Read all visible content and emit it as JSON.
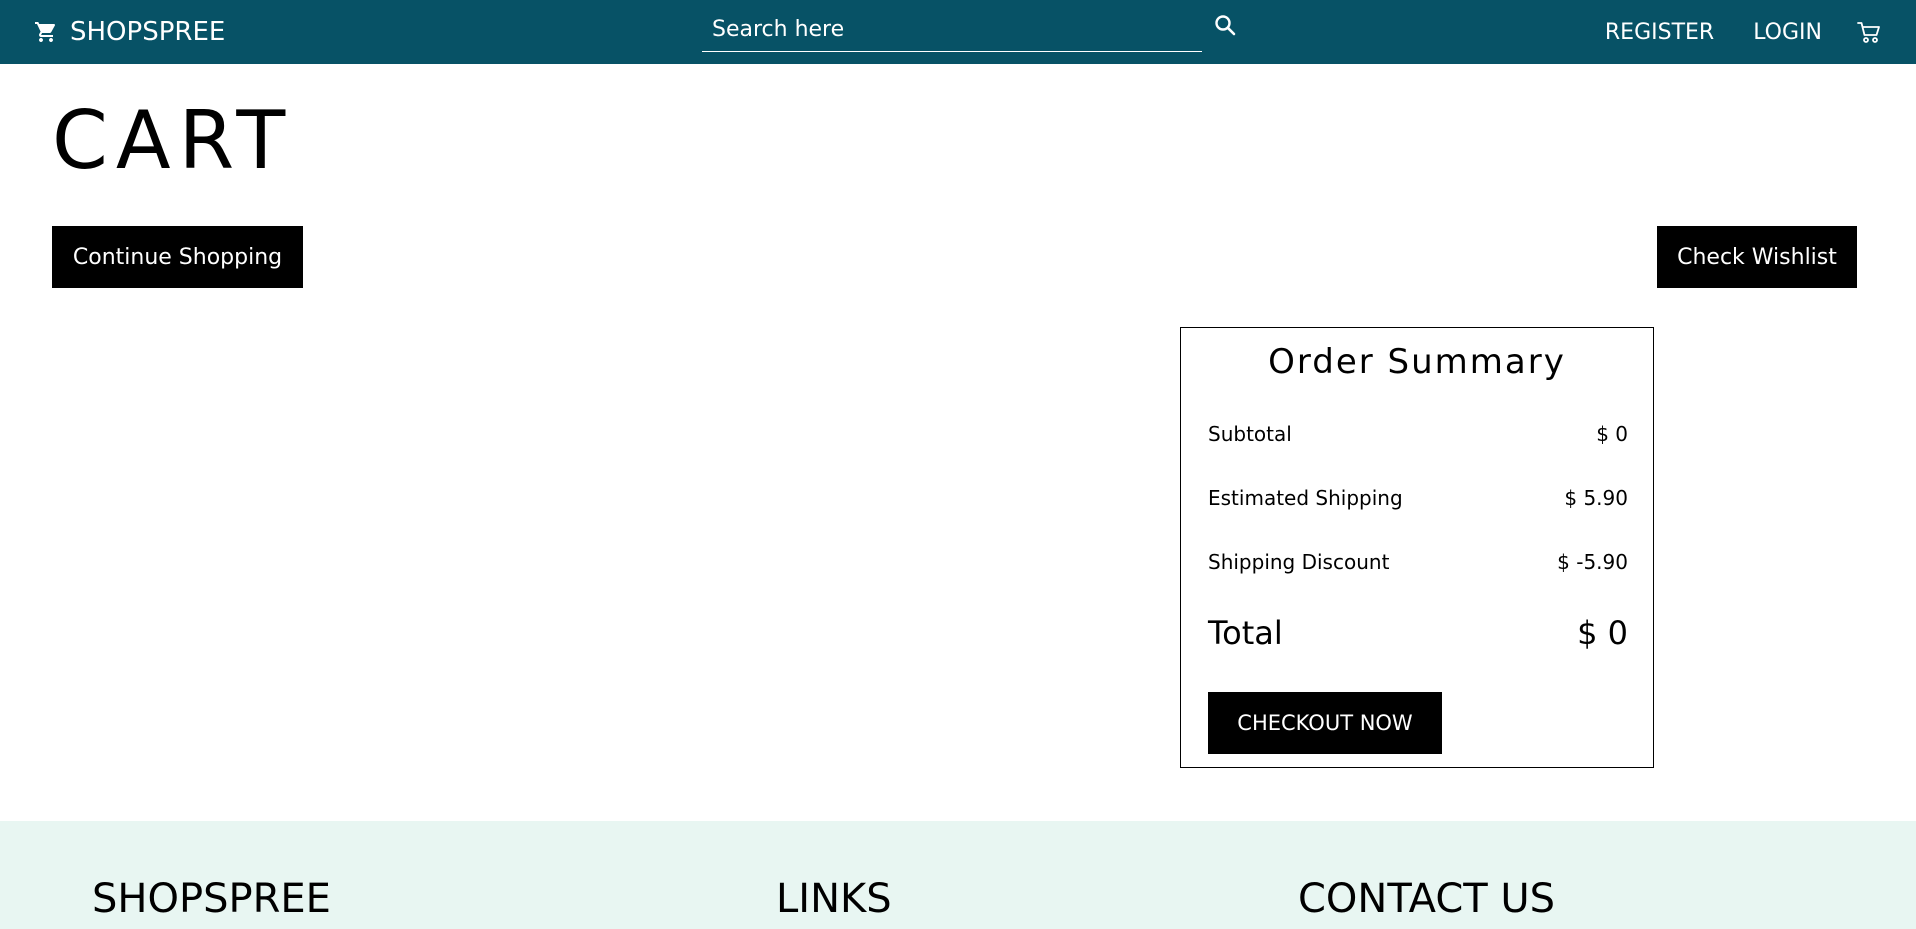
{
  "navbar": {
    "brand": "SHOPSPREE",
    "brand_icon": "shopping-cart-icon",
    "search_placeholder": "Search here",
    "search_icon": "search-icon",
    "register_label": "REGISTER",
    "login_label": "LOGIN",
    "cart_icon": "cart-outline-icon",
    "background_color": "#075266"
  },
  "page": {
    "title": "CART",
    "continue_label": "Continue Shopping",
    "wishlist_label": "Check Wishlist"
  },
  "summary": {
    "title": "Order Summary",
    "rows": [
      {
        "label": "Subtotal",
        "value": "$ 0"
      },
      {
        "label": "Estimated Shipping",
        "value": "$ 5.90"
      },
      {
        "label": "Shipping Discount",
        "value": "$ -5.90"
      }
    ],
    "total_label": "Total",
    "total_value": "$ 0",
    "checkout_label": "CHECKOUT NOW"
  },
  "footer": {
    "columns": [
      {
        "title": "SHOPSPREE"
      },
      {
        "title": "LINKS"
      },
      {
        "title": "CONTACT US"
      }
    ],
    "background_color": "#e8f6f2"
  }
}
